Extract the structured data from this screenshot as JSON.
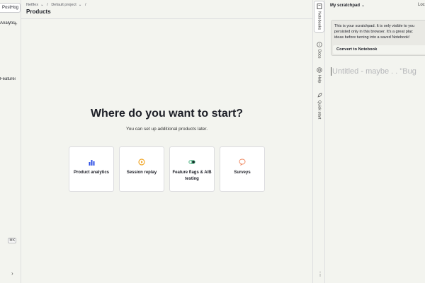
{
  "left_nav": {
    "project_label": "PostHog",
    "items": [
      {
        "label": "Analytics"
      },
      {
        "label": "Features"
      }
    ],
    "shortcut": "⌘K"
  },
  "breadcrumb": {
    "org": "Netflex",
    "project": "Default project",
    "separator": "/"
  },
  "page": {
    "title": "Products",
    "heading": "Where do you want to start?",
    "subheading": "You can set up additional products later."
  },
  "products": [
    {
      "label": "Product analytics",
      "icon": "bar-chart-icon",
      "color": "#2f51e6"
    },
    {
      "label": "Session replay",
      "icon": "play-circle-icon",
      "color": "#f1a82c"
    },
    {
      "label": "Feature flags & A/B testing",
      "icon": "toggle-icon",
      "color": "#30a46c"
    },
    {
      "label": "Surveys",
      "icon": "speech-bubble-icon",
      "color": "#f08b65"
    }
  ],
  "side_panel": {
    "tabs": [
      {
        "label": "Notebooks",
        "icon": "notebook-icon",
        "active": true
      },
      {
        "label": "Docs",
        "icon": "info-icon",
        "active": false
      },
      {
        "label": "Help",
        "icon": "help-icon",
        "active": false
      },
      {
        "label": "Quick start",
        "icon": "rocket-icon",
        "active": false
      }
    ]
  },
  "notebook": {
    "title": "My scratchpad",
    "location_label": "Loc",
    "info_lines": [
      "This is your scratchpad. It is only visible to you",
      "persisted only in this browser. It's a great plac",
      "ideas before turning into a saved Notebook!"
    ],
    "convert_label": "Convert to Notebook",
    "placeholder": "Untitled - maybe . . \"Bug"
  }
}
